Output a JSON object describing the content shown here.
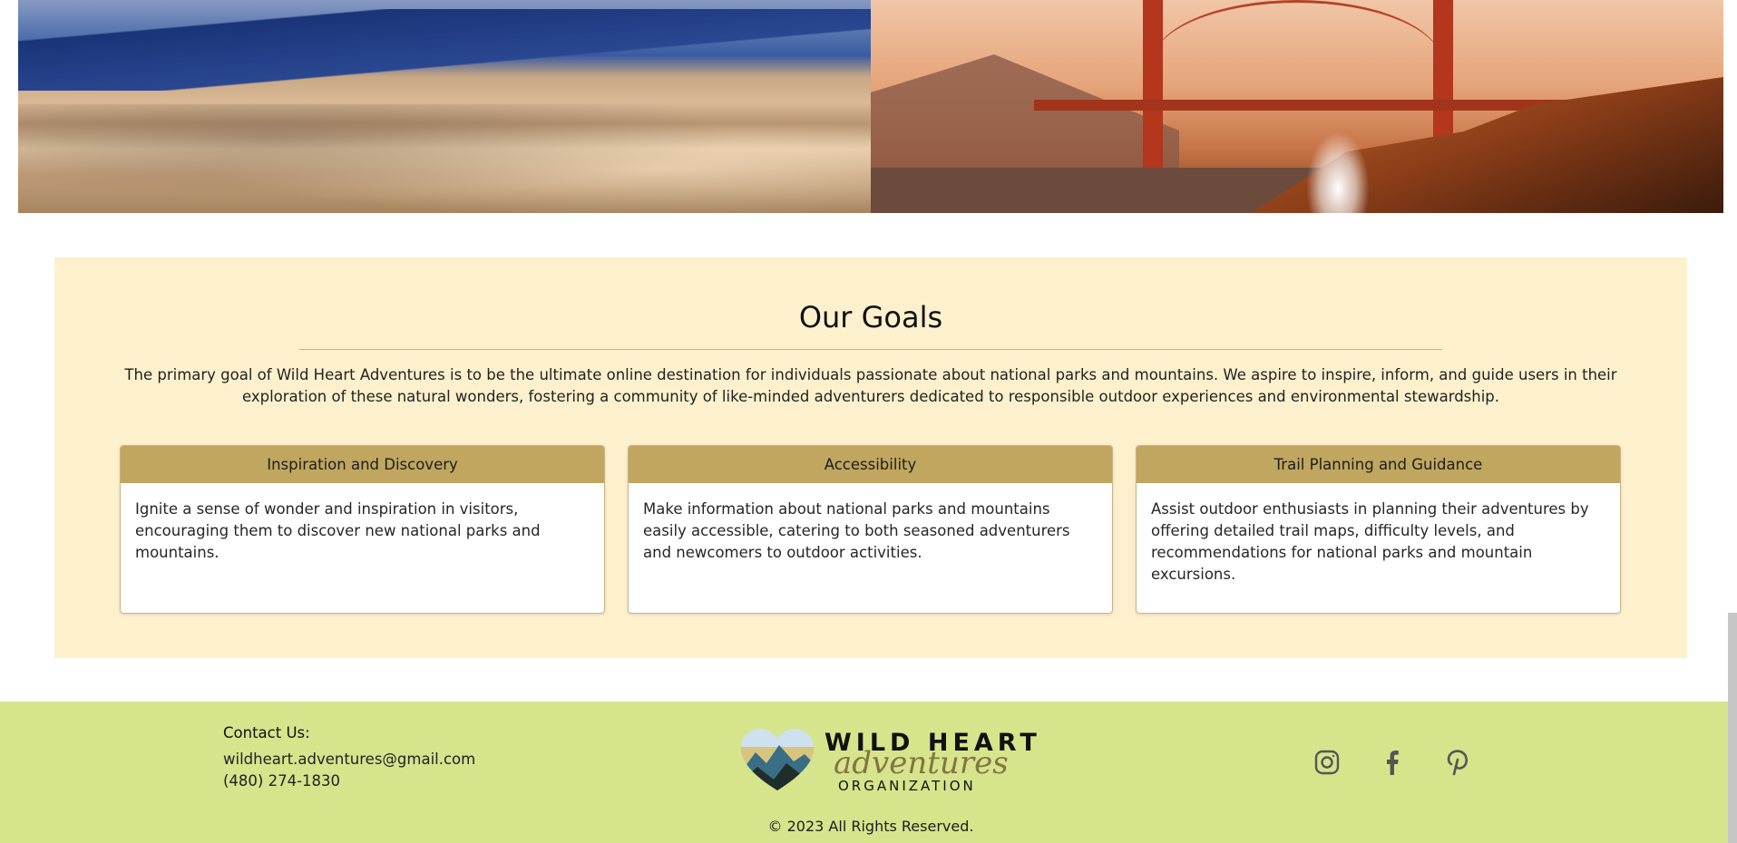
{
  "hero": {
    "left_image": "sand-dunes-photo",
    "right_image": "golden-gate-bridge-photo"
  },
  "goals": {
    "title": "Our Goals",
    "intro": "The primary goal of Wild Heart Adventures is to be the ultimate online destination for individuals passionate about national parks and mountains. We aspire to inspire, inform, and guide users in their exploration of these natural wonders, fostering a community of like-minded adventurers dedicated to responsible outdoor experiences and environmental stewardship.",
    "cards": [
      {
        "title": "Inspiration and Discovery",
        "body": "Ignite a sense of wonder and inspiration in visitors, encouraging them to discover new national parks and mountains."
      },
      {
        "title": "Accessibility",
        "body": "Make information about national parks and mountains easily accessible, catering to both seasoned adventurers and newcomers to outdoor activities."
      },
      {
        "title": "Trail Planning and Guidance",
        "body": "Assist outdoor enthusiasts in planning their adventures by offering detailed trail maps, difficulty levels, and recommendations for national parks and mountain excursions."
      }
    ]
  },
  "footer": {
    "contact_label": "Contact Us:",
    "email": "wildheart.adventures@gmail.com",
    "phone": "(480) 274-1830",
    "logo": {
      "line1": "WILD HEART",
      "line2": "adventures",
      "line3": "ORGANIZATION"
    },
    "copyright": "© 2023 All Rights Reserved.",
    "social": [
      "instagram-icon",
      "facebook-icon",
      "pinterest-icon"
    ]
  },
  "colors": {
    "goals_bg": "#fdf0cd",
    "card_header": "#c0a65f",
    "footer_bg": "#d6e48c"
  }
}
